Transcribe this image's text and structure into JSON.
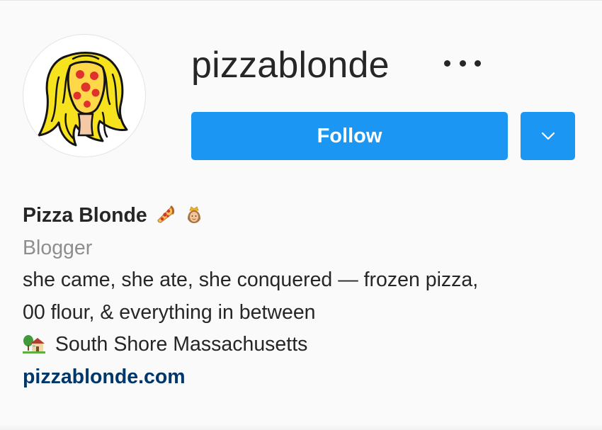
{
  "profile": {
    "username": "pizzablonde",
    "full_name": "Pizza Blonde",
    "category": "Blogger",
    "bio_line_1": "she came, she ate, she conquered — frozen pizza,",
    "bio_line_2": "00 flour, & everything in between",
    "location": "South Shore Massachusetts",
    "website": "pizzablonde.com"
  },
  "actions": {
    "follow_label": "Follow",
    "more_icon": "more-options-icon",
    "dropdown_icon": "chevron-down-icon"
  },
  "icons": {
    "name_emoji_1": "pizza-emoji",
    "name_emoji_2": "princess-emoji",
    "location_emoji": "house-with-garden-emoji"
  },
  "colors": {
    "primary_button": "#1c96f3",
    "link": "#00376b",
    "muted_text": "#8e8e8e",
    "text": "#262626",
    "background": "#fafafa"
  }
}
